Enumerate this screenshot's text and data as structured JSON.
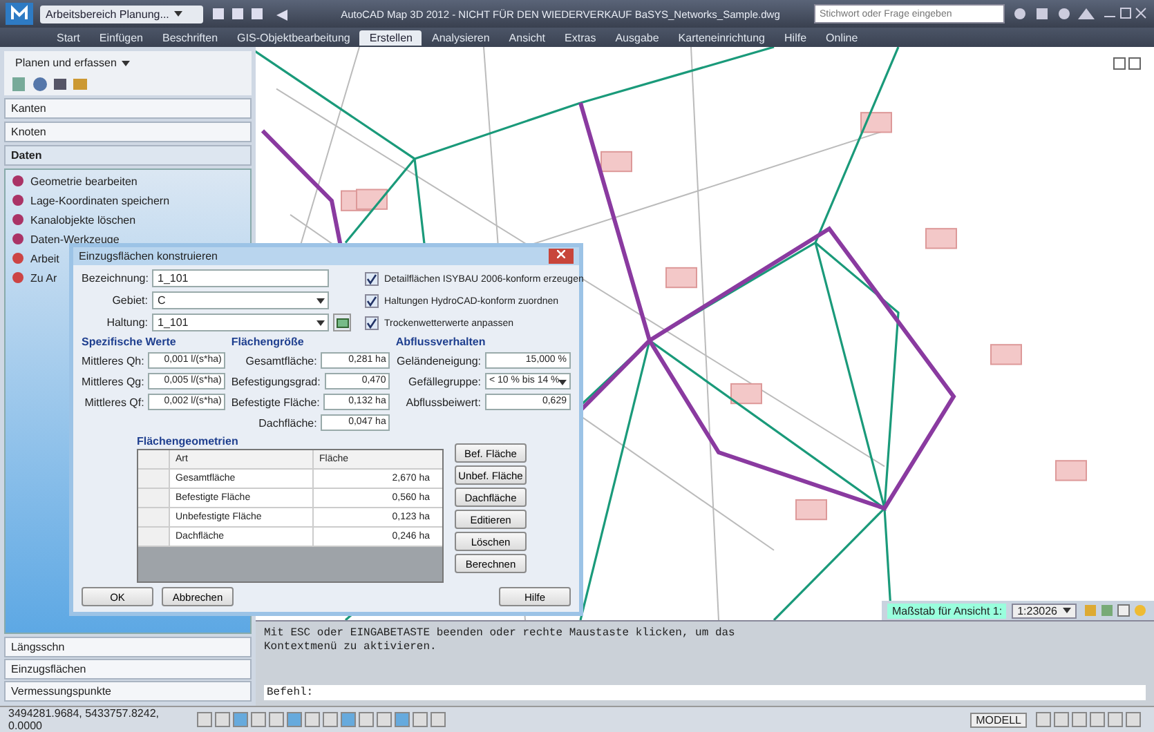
{
  "titlebar": {
    "workspace": "Arbeitsbereich Planung...",
    "title": "AutoCAD Map 3D 2012 - NICHT FÜR DEN WIEDERVERKAUF   BaSYS_Networks_Sample.dwg",
    "search": {
      "placeholder": "Stichwort oder Frage eingeben"
    }
  },
  "ribbon_tabs": [
    {
      "label": "Start",
      "selected": false
    },
    {
      "label": "Einfügen",
      "selected": false
    },
    {
      "label": "Beschriften",
      "selected": false
    },
    {
      "label": "GIS-Objektbearbeitung",
      "selected": false
    },
    {
      "label": "Erstellen",
      "selected": true
    },
    {
      "label": "Analysieren",
      "selected": false
    },
    {
      "label": "Ansicht",
      "selected": false
    },
    {
      "label": "Extras",
      "selected": false
    },
    {
      "label": "Ausgabe",
      "selected": false
    },
    {
      "label": "Karteneinrichtung",
      "selected": false
    },
    {
      "label": "Hilfe",
      "selected": false
    },
    {
      "label": "Online",
      "selected": false
    }
  ],
  "sidebar": {
    "dropdown": "Planen und erfassen",
    "sections": [
      {
        "label": "Kanten",
        "expanded": false
      },
      {
        "label": "Knoten",
        "expanded": false
      },
      {
        "label": "Daten",
        "expanded": true
      }
    ],
    "items": [
      "Geometrie bearbeiten",
      "Lage-Koordinaten speichern",
      "Kanalobjekte löschen",
      "Daten-Werkzeuge",
      "Arbeit",
      "Zu Ar"
    ],
    "bottom_sections": [
      "Längsschn",
      "Einzugsflächen",
      "Vermessungspunkte"
    ]
  },
  "dialog": {
    "title": "Einzugsflächen konstruieren",
    "fields": [
      {
        "label": "Bezeichnung:",
        "value": "1_101",
        "kind": "text"
      },
      {
        "label": "Gebiet:",
        "value": "C",
        "kind": "select"
      },
      {
        "label": "Haltung:",
        "value": "1_101",
        "kind": "select-pick"
      }
    ],
    "checkboxes": [
      {
        "label": "Detailflächen ISYBAU 2006-konform erzeugen",
        "checked": true
      },
      {
        "label": "Haltungen HydroCAD-konform zuordnen",
        "checked": true
      },
      {
        "label": "Trockenwetterwerte anpassen",
        "checked": true
      }
    ],
    "groups": [
      {
        "title": "Spezifische Werte",
        "rows": [
          {
            "label": "Mittleres Qh:",
            "value": "0,001 l/(s*ha)"
          },
          {
            "label": "Mittleres Qg:",
            "value": "0,005 l/(s*ha)"
          },
          {
            "label": "Mittleres Qf:",
            "value": "0,002 l/(s*ha)"
          }
        ]
      },
      {
        "title": "Flächengröße",
        "rows": [
          {
            "label": "Gesamtfläche:",
            "value": "0,281 ha"
          },
          {
            "label": "Befestigungsgrad:",
            "value": "0,470"
          },
          {
            "label": "Befestigte Fläche:",
            "value": "0,132 ha"
          },
          {
            "label": "Dachfläche:",
            "value": "0,047 ha"
          }
        ]
      },
      {
        "title": "Abflussverhalten",
        "rows": [
          {
            "label": "Geländeneigung:",
            "value": "15,000 %"
          },
          {
            "label": "Gefällegruppe:",
            "value": "< 10 % bis 14 %",
            "kind": "select"
          },
          {
            "label": "Abflussbeiwert:",
            "value": "0,629"
          }
        ]
      }
    ],
    "table": {
      "title": "Flächengeometrien",
      "columns": [
        "Art",
        "Fläche"
      ],
      "rows": [
        [
          "Gesamtfläche",
          "2,670 ha"
        ],
        [
          "Befestigte Fläche",
          "0,560 ha"
        ],
        [
          "Unbefestigte Fläche",
          "0,123 ha"
        ],
        [
          "Dachfläche",
          "0,246 ha"
        ]
      ]
    },
    "side_buttons": [
      "Bef. Fläche",
      "Unbef. Fläche",
      "Dachfläche",
      "Editieren",
      "Löschen",
      "Berechnen"
    ],
    "buttons": [
      "OK",
      "Abbrechen",
      "Hilfe"
    ]
  },
  "scale": {
    "label": "Maßstab für Ansicht 1:",
    "value": "1:23026"
  },
  "command": {
    "lines": [
      "Mit ESC oder EINGABETASTE beenden oder rechte Maustaste klicken, um das",
      "Kontextmenü zu aktivieren."
    ],
    "prompt": "Befehl:"
  },
  "status_bar": {
    "coordinates": "3494281.9684, 5433757.8242, 0.0000",
    "mode": "MODELL"
  }
}
